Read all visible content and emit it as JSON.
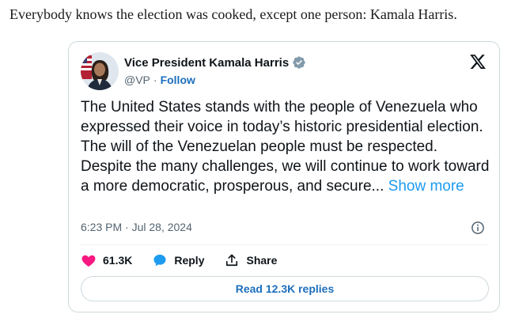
{
  "headline": "Everybody knows the election was cooked, except one person: Kamala Harris.",
  "tweet": {
    "author_name": "Vice President Kamala Harris",
    "handle": "@VP",
    "separator": "·",
    "follow_label": "Follow",
    "text": "The United States stands with the people of Venezuela who expressed their voice in today’s historic presidential election. The will of the Venezuelan people must be respected. Despite the many challenges, we will continue to work toward a more democratic, prosperous, and secure...",
    "show_more_label": "Show more",
    "timestamp": "6:23 PM · Jul 28, 2024",
    "like_count": "61.3K",
    "reply_label": "Reply",
    "share_label": "Share",
    "read_replies_label": "Read 12.3K replies"
  },
  "colors": {
    "like": "#f91880",
    "reply": "#1d9bf0",
    "link": "#1d6fbd",
    "verified": "#829aab"
  },
  "icons": [
    "verified-badge-icon",
    "x-logo-icon",
    "info-icon",
    "heart-icon",
    "reply-bubble-icon",
    "share-icon"
  ]
}
